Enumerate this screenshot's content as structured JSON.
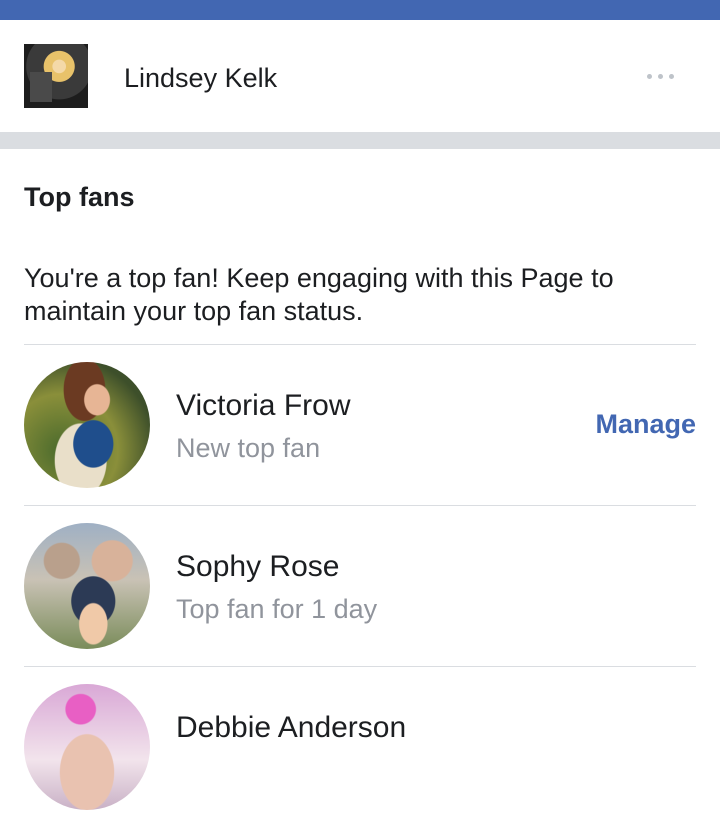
{
  "header": {
    "page_name": "Lindsey Kelk",
    "more_icon": "more-horizontal-icon"
  },
  "section": {
    "title": "Top fans",
    "intro": "You're a top fan! Keep engaging with this Page to maintain your top fan status."
  },
  "fans": [
    {
      "name": "Victoria Frow",
      "status": "New top fan",
      "action": "Manage"
    },
    {
      "name": "Sophy Rose",
      "status": "Top fan for 1 day"
    },
    {
      "name": "Debbie Anderson"
    }
  ],
  "colors": {
    "brand_bar": "#4267b2",
    "link": "#4267b2",
    "secondary_text": "#90949c",
    "divider": "#dadde1"
  }
}
